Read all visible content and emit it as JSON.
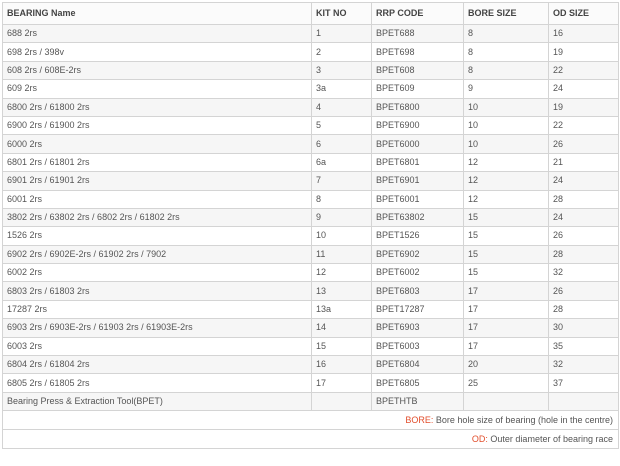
{
  "headers": [
    "BEARING Name",
    "KIT NO",
    "RRP CODE",
    "BORE SIZE",
    "OD SIZE"
  ],
  "rows": [
    [
      "688 2rs",
      "1",
      "BPET688",
      "8",
      "16"
    ],
    [
      "698 2rs / 398v",
      "2",
      "BPET698",
      "8",
      "19"
    ],
    [
      "608 2rs / 608E-2rs",
      "3",
      "BPET608",
      "8",
      "22"
    ],
    [
      "609 2rs",
      "3a",
      "BPET609",
      "9",
      "24"
    ],
    [
      "6800 2rs / 61800 2rs",
      "4",
      "BPET6800",
      "10",
      "19"
    ],
    [
      "6900 2rs / 61900 2rs",
      "5",
      "BPET6900",
      "10",
      "22"
    ],
    [
      "6000 2rs",
      "6",
      "BPET6000",
      "10",
      "26"
    ],
    [
      "6801 2rs / 61801 2rs",
      "6a",
      "BPET6801",
      "12",
      "21"
    ],
    [
      "6901 2rs / 61901 2rs",
      "7",
      "BPET6901",
      "12",
      "24"
    ],
    [
      "6001 2rs",
      "8",
      "BPET6001",
      "12",
      "28"
    ],
    [
      "3802 2rs / 63802 2rs / 6802 2rs / 61802 2rs",
      "9",
      "BPET63802",
      "15",
      "24"
    ],
    [
      "1526 2rs",
      "10",
      "BPET1526",
      "15",
      "26"
    ],
    [
      "6902 2rs / 6902E-2rs / 61902 2rs / 7902",
      "11",
      "BPET6902",
      "15",
      "28"
    ],
    [
      "6002 2rs",
      "12",
      "BPET6002",
      "15",
      "32"
    ],
    [
      "6803 2rs / 61803 2rs",
      "13",
      "BPET6803",
      "17",
      "26"
    ],
    [
      "17287 2rs",
      "13a",
      "BPET17287",
      "17",
      "28"
    ],
    [
      "6903 2rs / 6903E-2rs / 61903 2rs / 61903E-2rs",
      "14",
      "BPET6903",
      "17",
      "30"
    ],
    [
      "6003 2rs",
      "15",
      "BPET6003",
      "17",
      "35"
    ],
    [
      "6804 2rs / 61804 2rs",
      "16",
      "BPET6804",
      "20",
      "32"
    ],
    [
      "6805 2rs / 61805 2rs",
      "17",
      "BPET6805",
      "25",
      "37"
    ],
    [
      "Bearing Press & Extraction Tool(BPET)",
      "",
      "BPETHTB",
      "",
      ""
    ]
  ],
  "legend": [
    {
      "key": "BORE:",
      "text": " Bore hole size of bearing (hole in the centre)"
    },
    {
      "key": "OD:",
      "text": " Outer diameter of bearing race"
    }
  ],
  "colors": {
    "legend_key": "#e24e2c",
    "border": "#d4d4d4",
    "stripe": "#f6f6f6"
  }
}
